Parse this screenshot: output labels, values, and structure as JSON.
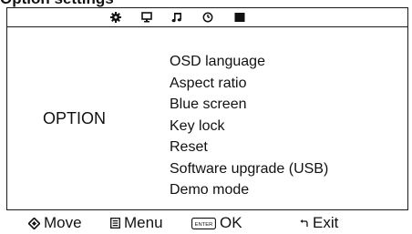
{
  "page": {
    "title": "Option settings"
  },
  "icon_bar": {
    "tabs": [
      {
        "icon": "gear-icon",
        "active": false
      },
      {
        "icon": "monitor-icon",
        "active": false
      },
      {
        "icon": "music-note-icon",
        "active": false
      },
      {
        "icon": "clock-icon",
        "active": false
      },
      {
        "icon": "option-block-icon",
        "active": true
      }
    ]
  },
  "category": {
    "label": "OPTION"
  },
  "options": [
    "OSD language",
    "Aspect ratio",
    "Blue screen",
    "Key lock",
    "Reset",
    "Software upgrade (USB)",
    "Demo mode"
  ],
  "legend": {
    "move": {
      "icon": "directional-pad-icon",
      "label": "Move"
    },
    "menu": {
      "icon": "menu-icon",
      "label": "Menu"
    },
    "ok": {
      "icon": "enter-key-icon",
      "key": "ENTER",
      "label": "OK"
    },
    "exit": {
      "icon": "return-arrow-icon",
      "label": "Exit"
    }
  },
  "colors": {
    "foreground": "#111111",
    "background": "#ffffff",
    "frame": "#1a1a1a"
  }
}
